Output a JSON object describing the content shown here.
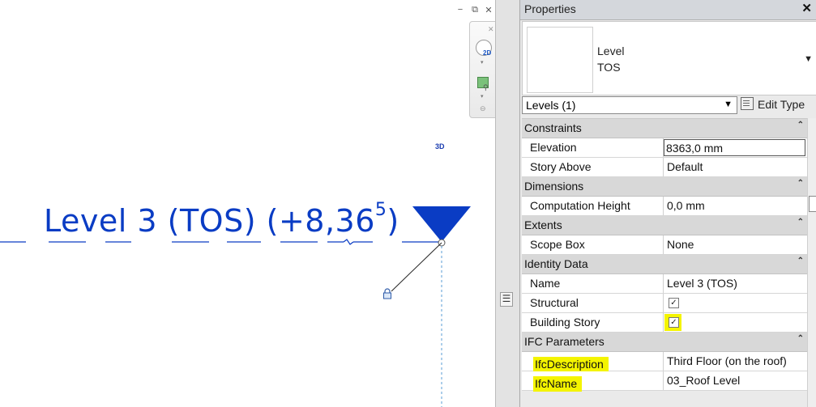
{
  "canvas": {
    "window_controls": [
      "−",
      "⧉",
      "✕"
    ],
    "view_label_3d": "3D",
    "level_name": "Level 3 (TOS) (+8,36",
    "level_elevation_superscript": "5",
    "level_name_close": ")",
    "navbar": {
      "close": "✕",
      "mode_label": "2D",
      "arrow1": "▾",
      "arrow2": "▾",
      "end": "⊖"
    }
  },
  "splitter": {
    "grip": "☰"
  },
  "properties": {
    "title": "Properties",
    "close": "✕",
    "type_family": "Level",
    "type_name": "TOS",
    "type_dropdown": "▼",
    "filter_value": "Levels (1)",
    "filter_arrow": "▼",
    "edit_type_label": "Edit Type",
    "collapse_glyph": "⌃",
    "groups": {
      "constraints": "Constraints",
      "dimensions": "Dimensions",
      "extents": "Extents",
      "identity": "Identity Data",
      "ifc": "IFC Parameters"
    },
    "rows": {
      "elevation": {
        "name": "Elevation",
        "value": "8363,0 mm"
      },
      "story_above": {
        "name": "Story Above",
        "value": "Default"
      },
      "computation_height": {
        "name": "Computation Height",
        "value": "0,0 mm"
      },
      "scope_box": {
        "name": "Scope Box",
        "value": "None"
      },
      "name": {
        "name": "Name",
        "value": "Level 3 (TOS)"
      },
      "structural": {
        "name": "Structural",
        "checked": "✓"
      },
      "building_story": {
        "name": "Building Story",
        "checked": "✓"
      },
      "ifc_description": {
        "name": "IfcDescription",
        "value": "Third Floor (on the roof)"
      },
      "ifc_name": {
        "name": "IfcName",
        "value": "03_Roof Level"
      }
    }
  },
  "colors": {
    "level_blue": "#0a3cc4",
    "highlight_yellow": "#f4f400",
    "group_header_gray": "#d8d8d8"
  },
  "icons": [
    "minimize-icon",
    "restore-icon",
    "close-icon",
    "steering-wheel-icon",
    "zoom-icon",
    "lock-icon",
    "level-head-triangle-icon",
    "edit-type-icon",
    "chevron-collapse-icon",
    "checkbox-icon"
  ]
}
